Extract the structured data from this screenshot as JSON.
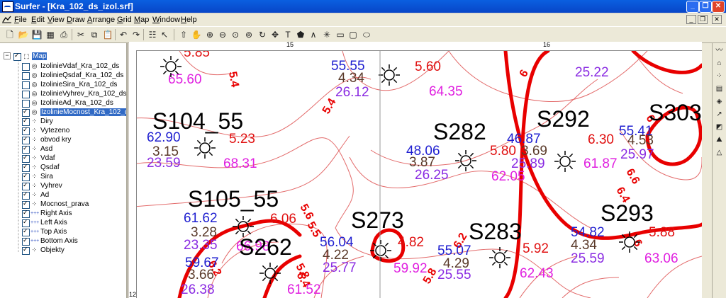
{
  "window": {
    "title": "Surfer - [Kra_102_ds_izol.srf]",
    "buttons": {
      "minimize": "_",
      "maximize": "❐",
      "close": "✕"
    }
  },
  "menu": [
    "File",
    "Edit",
    "View",
    "Draw",
    "Arrange",
    "Grid",
    "Map",
    "Window",
    "Help"
  ],
  "mdi_buttons": {
    "minimize": "_",
    "restore": "❐",
    "close": "✕"
  },
  "toolbar_icons": [
    "new-icon",
    "open-icon",
    "save-icon",
    "worksheet-icon",
    "print-icon",
    "cut-icon",
    "copy-icon",
    "paste-icon",
    "undo-icon",
    "redo-icon",
    "object-manager-icon",
    "help-pointer-icon",
    "select-arrow-icon",
    "pan-hand-icon",
    "zoom-in-icon",
    "zoom-out-icon",
    "zoom-rect-icon",
    "zoom-page-icon",
    "rotate-icon",
    "move-icon",
    "text-icon",
    "polygon-icon",
    "polyline-icon",
    "symbol-icon",
    "rectangle-icon",
    "rounded-rect-icon",
    "ellipse-icon"
  ],
  "tree": {
    "root": "Map",
    "items": [
      {
        "label": "IzolinieVdaf_Kra_102_ds",
        "checked": false,
        "icon": "contour-icon"
      },
      {
        "label": "IzolinieQsdaf_Kra_102_ds",
        "checked": false,
        "icon": "contour-icon"
      },
      {
        "label": "IzolinieSira_Kra_102_ds",
        "checked": false,
        "icon": "contour-icon"
      },
      {
        "label": "IzolinieVyhrev_Kra_102_ds",
        "checked": false,
        "icon": "contour-icon"
      },
      {
        "label": "IzolinieAd_Kra_102_ds",
        "checked": false,
        "icon": "contour-icon"
      },
      {
        "label": "IzolinieMocnost_Kra_102_ds",
        "checked": true,
        "icon": "contour-icon",
        "selected": true
      },
      {
        "label": "Diry",
        "checked": true,
        "icon": "post-icon"
      },
      {
        "label": "Vytezeno",
        "checked": true,
        "icon": "post-icon"
      },
      {
        "label": "obvod kry",
        "checked": true,
        "icon": "post-icon"
      },
      {
        "label": "Asd",
        "checked": true,
        "icon": "post-icon"
      },
      {
        "label": "Vdaf",
        "checked": true,
        "icon": "post-icon"
      },
      {
        "label": "Qsdaf",
        "checked": true,
        "icon": "post-icon"
      },
      {
        "label": "Sira",
        "checked": true,
        "icon": "post-icon"
      },
      {
        "label": "Vyhrev",
        "checked": true,
        "icon": "post-icon"
      },
      {
        "label": "Ad",
        "checked": true,
        "icon": "post-icon"
      },
      {
        "label": "Mocnost_prava",
        "checked": true,
        "icon": "post-icon"
      },
      {
        "label": "Right Axis",
        "checked": true,
        "icon": "axis-icon"
      },
      {
        "label": "Left Axis",
        "checked": true,
        "icon": "axis-icon"
      },
      {
        "label": "Top Axis",
        "checked": true,
        "icon": "axis-icon"
      },
      {
        "label": "Bottom Axis",
        "checked": true,
        "icon": "axis-icon"
      },
      {
        "label": "Objekty",
        "checked": true,
        "icon": "post-icon"
      }
    ]
  },
  "ruler": {
    "top_ticks": [
      "15",
      "16"
    ],
    "left_ticks": [
      "12"
    ]
  },
  "map": {
    "colors": {
      "contour": "#e36b6b",
      "heavy": "#e80000",
      "blue": "#1f1fd0",
      "brown": "#5a3a2a",
      "purple": "#8a2be2",
      "magenta": "#e020e0",
      "red": "#e01010",
      "black": "#000000"
    },
    "stations": [
      {
        "name": "S104_55",
        "color": "black"
      },
      {
        "name": "S105_55",
        "color": "black"
      },
      {
        "name": "S262",
        "color": "black"
      },
      {
        "name": "S273",
        "color": "black"
      },
      {
        "name": "S282",
        "color": "black"
      },
      {
        "name": "S283",
        "color": "black"
      },
      {
        "name": "S292",
        "color": "black"
      },
      {
        "name": "S293",
        "color": "black"
      },
      {
        "name": "S303",
        "color": "black"
      }
    ],
    "labels": [
      {
        "text": "5.85",
        "color": "red"
      },
      {
        "text": "65.60",
        "color": "magenta"
      },
      {
        "text": "55.55",
        "color": "blue"
      },
      {
        "text": "4.34",
        "color": "brown"
      },
      {
        "text": "5.60",
        "color": "red"
      },
      {
        "text": "26.12",
        "color": "purple"
      },
      {
        "text": "64.35",
        "color": "magenta"
      },
      {
        "text": "25.22",
        "color": "purple"
      },
      {
        "text": "62.90",
        "color": "blue"
      },
      {
        "text": "5.23",
        "color": "red"
      },
      {
        "text": "3.15",
        "color": "brown"
      },
      {
        "text": "23.59",
        "color": "purple"
      },
      {
        "text": "68.31",
        "color": "magenta"
      },
      {
        "text": "48.06",
        "color": "blue"
      },
      {
        "text": "3.87",
        "color": "brown"
      },
      {
        "text": "26.25",
        "color": "purple"
      },
      {
        "text": "5.80",
        "color": "red"
      },
      {
        "text": "62.05",
        "color": "magenta"
      },
      {
        "text": "46.87",
        "color": "blue"
      },
      {
        "text": "3.69",
        "color": "brown"
      },
      {
        "text": "25.89",
        "color": "purple"
      },
      {
        "text": "6.30",
        "color": "red"
      },
      {
        "text": "61.87",
        "color": "magenta"
      },
      {
        "text": "55.41",
        "color": "blue"
      },
      {
        "text": "4.53",
        "color": "brown"
      },
      {
        "text": "25.97",
        "color": "purple"
      },
      {
        "text": "61.62",
        "color": "blue"
      },
      {
        "text": "6.06",
        "color": "red"
      },
      {
        "text": "3.28",
        "color": "brown"
      },
      {
        "text": "23.35",
        "color": "purple"
      },
      {
        "text": "66.98",
        "color": "magenta"
      },
      {
        "text": "59.67",
        "color": "blue"
      },
      {
        "text": "3.66",
        "color": "brown"
      },
      {
        "text": "26.38",
        "color": "purple"
      },
      {
        "text": "61.52",
        "color": "magenta"
      },
      {
        "text": "56.04",
        "color": "blue"
      },
      {
        "text": "4.22",
        "color": "brown"
      },
      {
        "text": "25.77",
        "color": "purple"
      },
      {
        "text": "4.82",
        "color": "red"
      },
      {
        "text": "59.92",
        "color": "magenta"
      },
      {
        "text": "55.07",
        "color": "blue"
      },
      {
        "text": "4.29",
        "color": "brown"
      },
      {
        "text": "25.55",
        "color": "purple"
      },
      {
        "text": "5.92",
        "color": "red"
      },
      {
        "text": "62.43",
        "color": "magenta"
      },
      {
        "text": "54.82",
        "color": "blue"
      },
      {
        "text": "4.34",
        "color": "brown"
      },
      {
        "text": "25.59",
        "color": "purple"
      },
      {
        "text": "5.88",
        "color": "red"
      },
      {
        "text": "63.06",
        "color": "magenta"
      }
    ],
    "contour_labels": [
      "5.4",
      "5.4",
      "5.6",
      "5.5",
      "6",
      "6.2",
      "6.4",
      "5.8",
      "6.6",
      "6.4",
      "6",
      "6.2",
      "5.8",
      "6"
    ]
  }
}
